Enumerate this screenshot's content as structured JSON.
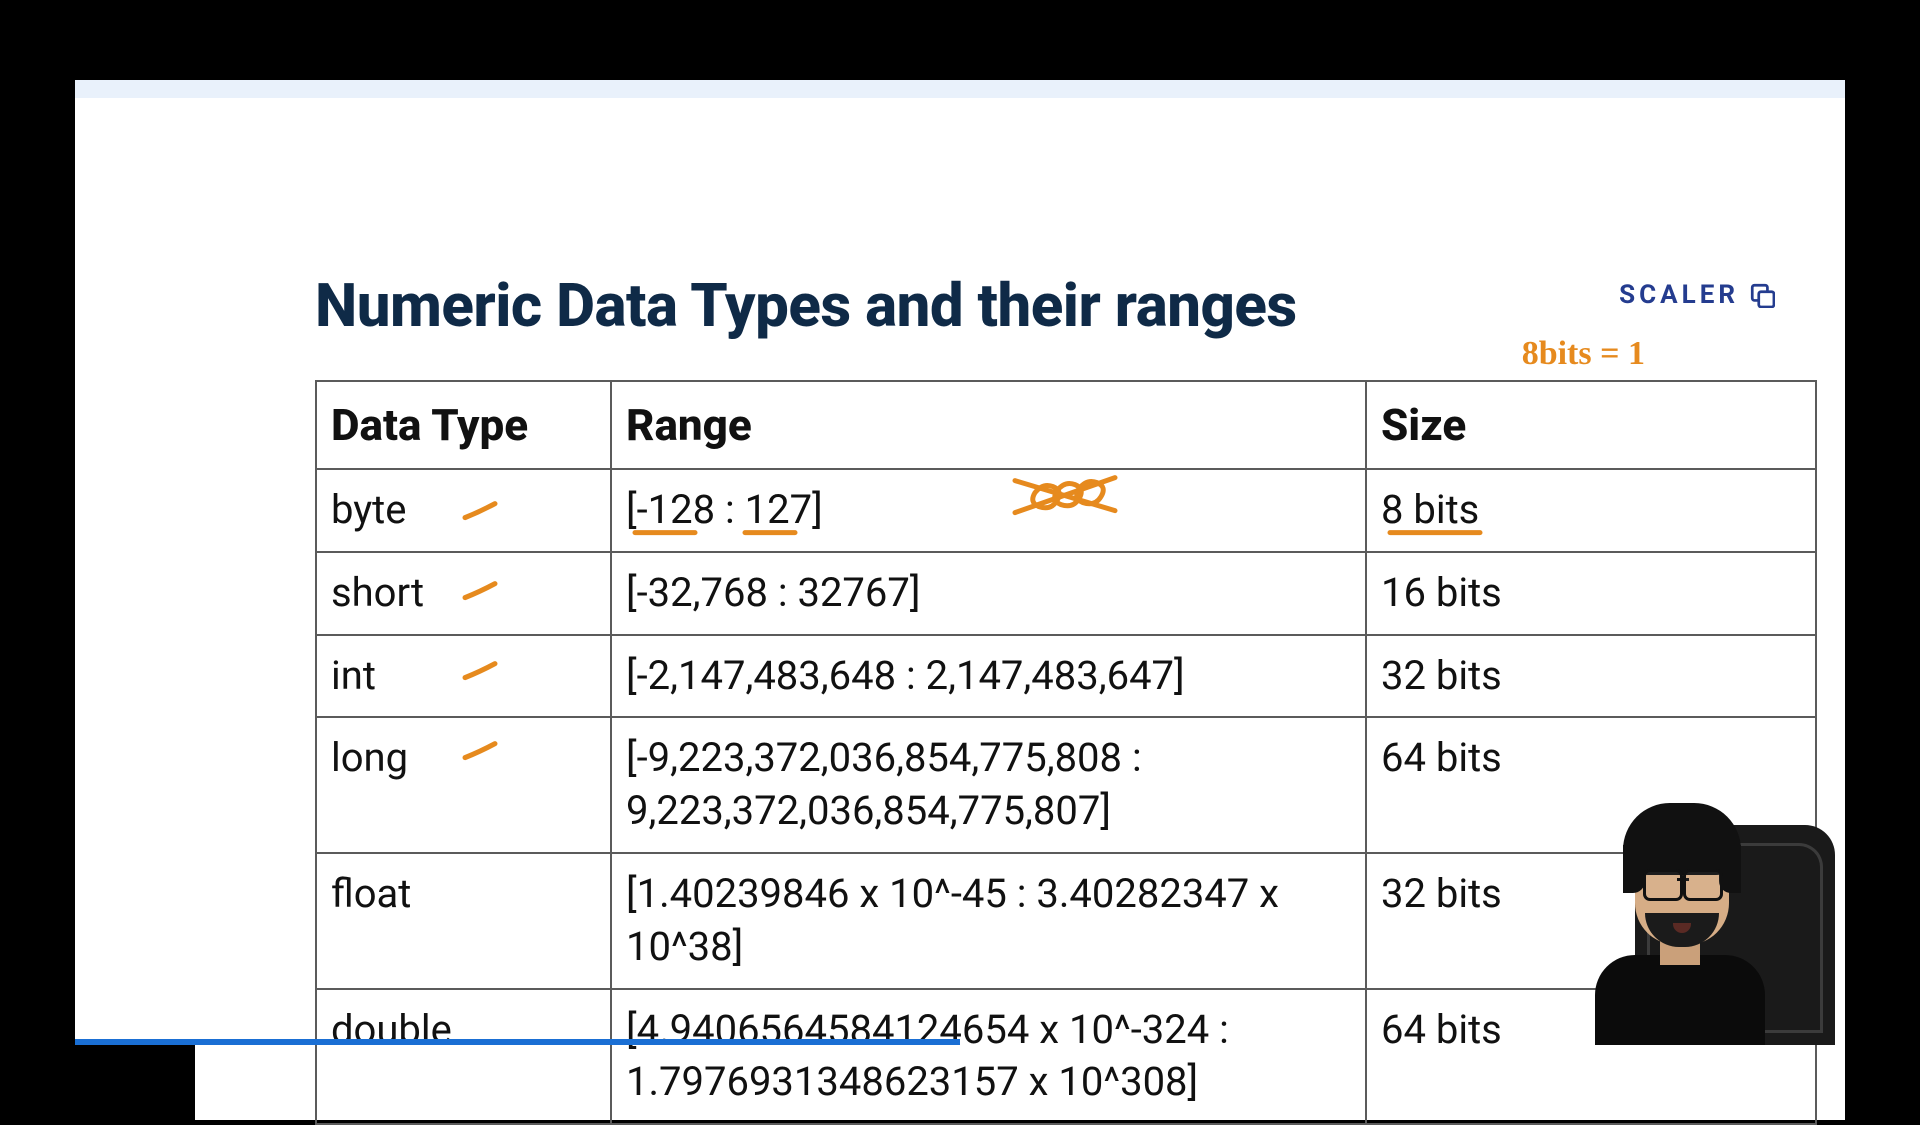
{
  "title": "Numeric Data Types and their ranges",
  "brand": {
    "name": "SCALER"
  },
  "handwritten_note": "8bits  =  1",
  "table": {
    "headers": {
      "col1": "Data Type",
      "col2": "Range",
      "col3": "Size"
    },
    "rows": [
      {
        "type": "byte",
        "range": "[-128 : 127]",
        "size": "8 bits"
      },
      {
        "type": "short",
        "range": "[-32,768 : 32767]",
        "size": "16 bits"
      },
      {
        "type": "int",
        "range": "[-2,147,483,648 : 2,147,483,647]",
        "size": "32 bits"
      },
      {
        "type": "long",
        "range": "[-9,223,372,036,854,775,808 : 9,223,372,036,854,775,807]",
        "size": "64 bits"
      },
      {
        "type": "float",
        "range": "[1.40239846 x 10^-45 : 3.40282347 x 10^38]",
        "size": "32 bits"
      },
      {
        "type": "double",
        "range": "[4.9406564584124654 x 10^-324 : 1.7976931348623157 x 10^308]",
        "size": "64 bits"
      }
    ]
  }
}
